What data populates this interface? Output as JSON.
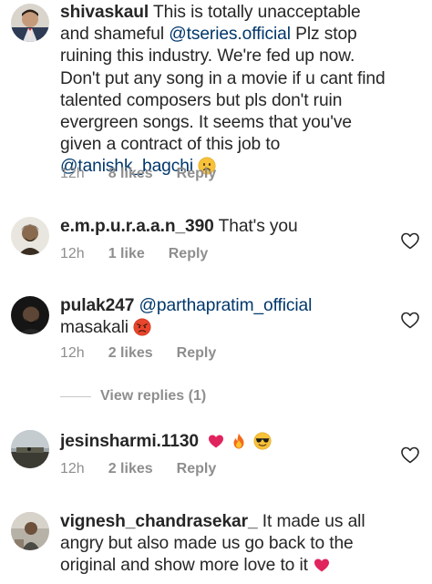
{
  "comments": [
    {
      "username": "shivaskaul",
      "text_before": " This is totally unacceptable and shameful ",
      "mention1": "@tseries.official",
      "text_middle": " Plz stop ruining this industry. We're fed up now. Don't put any song in a movie if u cant find talented composers but pls don't ruin evergreen songs. It seems that you've given a contract of this job to ",
      "mention2": "@tanishk_bagchi",
      "emoji": "frowning-face-emoji",
      "time": "12h",
      "likes": "8 likes",
      "reply": "Reply"
    },
    {
      "username": "e.m.p.u.r.a.a.n_390",
      "text": " That's you",
      "time": "12h",
      "likes": "1 like",
      "reply": "Reply"
    },
    {
      "username": "pulak247",
      "mention": " @parthapratim_official",
      "text": "masakali ",
      "emoji": "angry-face-emoji",
      "time": "12h",
      "likes": "2 likes",
      "reply": "Reply",
      "view_replies": "View replies (1)"
    },
    {
      "username": "jesinsharmi.1130",
      "emojis": [
        "red-heart-emoji",
        "fire-emoji",
        "sunglasses-face-emoji"
      ],
      "time": "12h",
      "likes": "2 likes",
      "reply": "Reply"
    },
    {
      "username": "vignesh_chandrasekar_",
      "text": " It made us all angry but also made us go back to the original and show more love to it ",
      "emoji": "red-heart-emoji"
    }
  ],
  "colors": {
    "text": "#262626",
    "mention": "#00376b",
    "meta": "#8e8e8e",
    "heart_emoji": "#e0245e"
  },
  "icons": {
    "like": "heart-outline-icon"
  }
}
